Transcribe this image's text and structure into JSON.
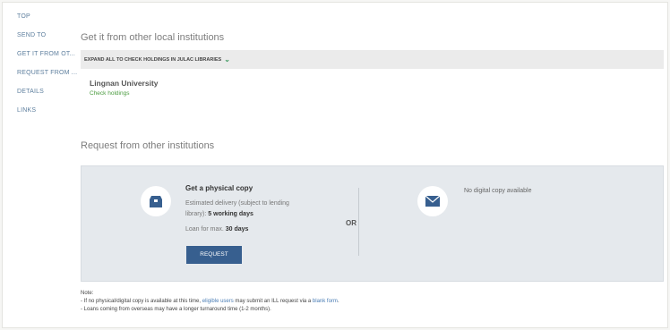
{
  "nav": {
    "items": [
      {
        "label": "TOP"
      },
      {
        "label": "SEND TO"
      },
      {
        "label": "GET IT FROM OT..."
      },
      {
        "label": "REQUEST FROM ..."
      },
      {
        "label": "DETAILS"
      },
      {
        "label": "LINKS"
      }
    ]
  },
  "get_it": {
    "title": "Get it from other local institutions",
    "expand_label": "EXPAND ALL TO CHECK HOLDINGS IN JULAC LIBRARIES",
    "institution": "Lingnan University",
    "check_link": "Check holdings"
  },
  "request": {
    "title": "Request from other institutions",
    "physical_title": "Get a physical copy",
    "delivery_line1": "Estimated delivery (subject to lending",
    "delivery_line2_prefix": "library): ",
    "delivery_days": "5 working days",
    "loan_prefix": "Loan for max. ",
    "loan_days": "30 days",
    "button_label": "REQUEST",
    "or_label": "OR",
    "digital_text": "No digital copy available"
  },
  "note": {
    "heading": "Note:",
    "line1_a": "- If no physical/digital copy is available at this time, ",
    "line1_link1": "eligible users",
    "line1_b": " may submit an ILL request via a ",
    "line1_link2": "blank form",
    "line1_c": ".",
    "line2": "- Loans coming from overseas may have a longer turnaround time (1-2 months)."
  },
  "colors": {
    "accent": "#375f8f",
    "link_green": "#4a9b3f",
    "link_blue": "#4a7db5",
    "panel_bg": "#e5e9ed"
  },
  "icons": {
    "physical": "box-icon",
    "digital": "envelope-icon",
    "expand": "chevron-down-icon"
  }
}
